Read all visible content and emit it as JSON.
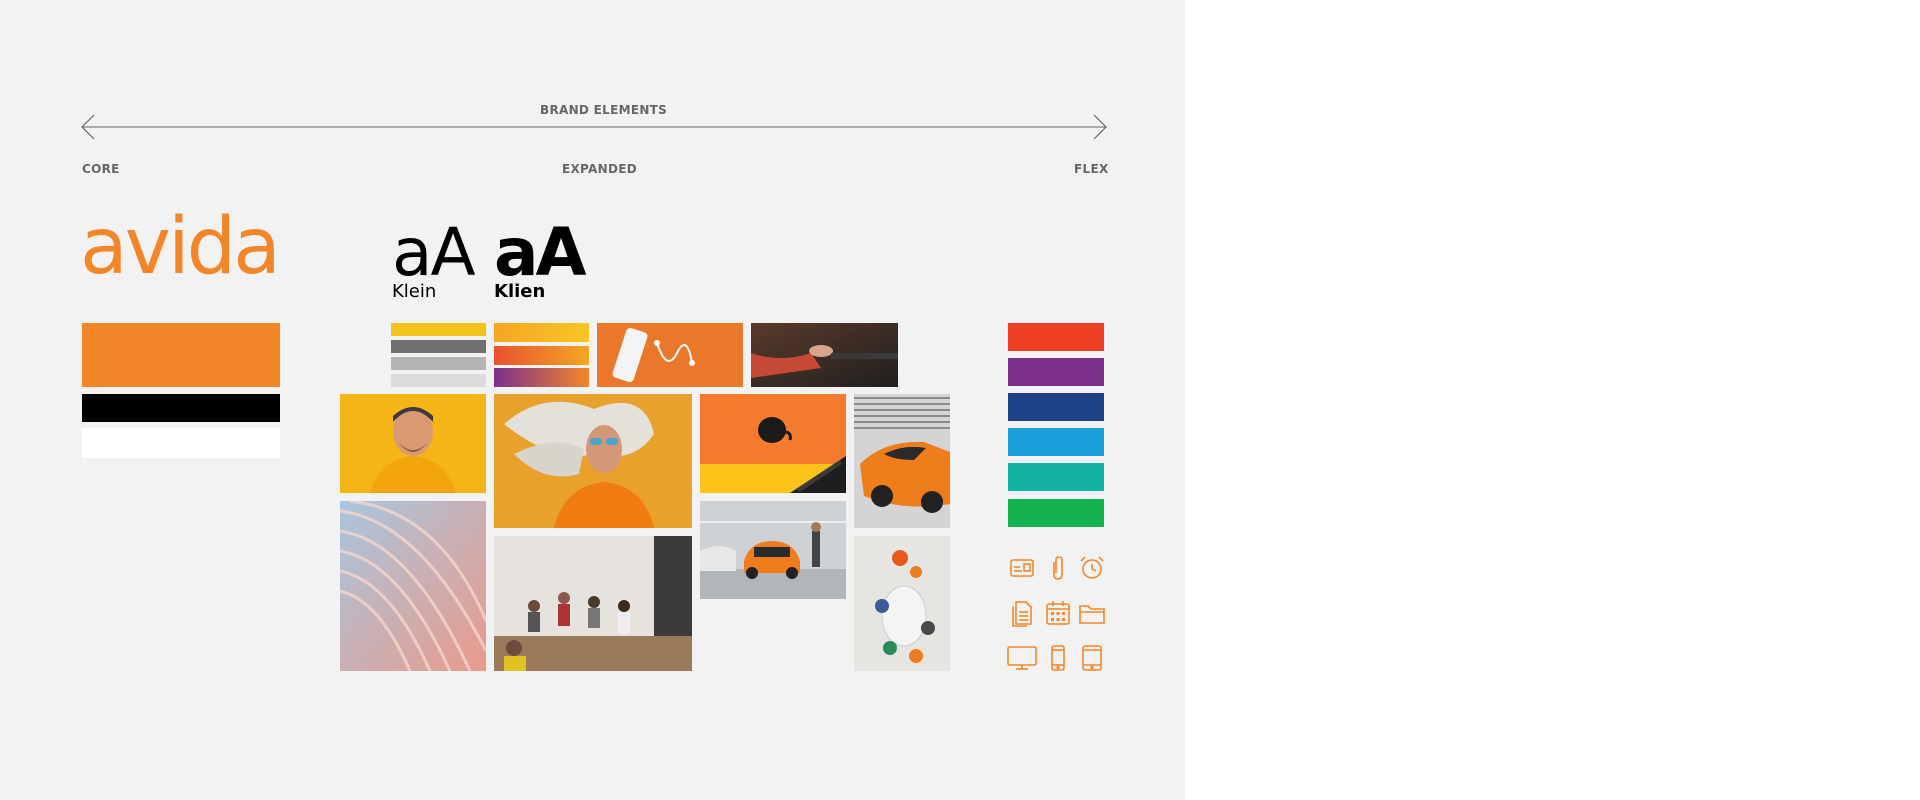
{
  "header": {
    "title": "BRAND ELEMENTS",
    "left_label": "CORE",
    "center_label": "EXPANDED",
    "right_label": "FLEX"
  },
  "logo": {
    "text": "avida"
  },
  "typography": {
    "sample_light": "aA",
    "caption_light": "Klein",
    "sample_bold": "aA",
    "caption_bold": "Klien"
  },
  "colors": {
    "panel_bg": "#f2f2f2",
    "core": [
      "#f4862a",
      "#000000",
      "#ffffff"
    ],
    "expanded_bars": [
      "#f5c21b",
      "#707070",
      "#b4b4b4",
      "#dcdcdc"
    ],
    "gradient_bars": [
      [
        "#f5a623",
        "#f7c624"
      ],
      [
        "#e8522f",
        "#f5a623"
      ],
      [
        "#7b2f8c",
        "#f5862a"
      ]
    ],
    "flex": [
      "#ef3e26",
      "#7b2f8c",
      "#1f4185",
      "#1a9fd8",
      "#14b2a4",
      "#14b14f"
    ],
    "icon_color": "#f4862a"
  },
  "photos": [
    "phone-earbuds-photo",
    "hand-on-device-photo",
    "smiling-man-yellow-sweater-photo",
    "woman-gray-hair-sunglasses-photo",
    "coffee-cup-keyboard-photo",
    "orange-sports-car-photo",
    "abstract-pink-blue-curves-photo",
    "people-in-cafe-photo",
    "car-showroom-photo",
    "aerial-table-people-photo"
  ],
  "icons": [
    "id-card-icon",
    "paperclip-icon",
    "alarm-clock-icon",
    "document-icon",
    "calendar-icon",
    "folder-icon",
    "monitor-icon",
    "smartphone-icon",
    "tablet-icon"
  ]
}
